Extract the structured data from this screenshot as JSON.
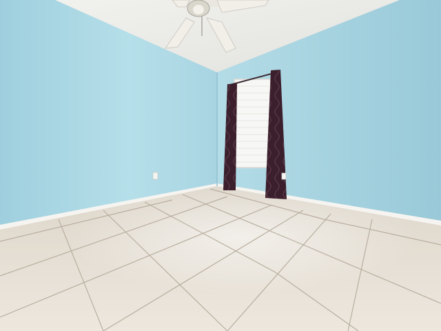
{
  "scene": {
    "subject": "empty room",
    "colors": {
      "wall": "#a9d6e3",
      "wall_shadow": "#9ecbd9",
      "ceiling": "#eeeeea",
      "floor": "#e8e2d8",
      "grout": "#b8ada0",
      "baseboard": "#f4f2ee",
      "curtain": "#3b1f2c",
      "window_glass": "#f7f7f5",
      "fan": "#f1efe8"
    },
    "icons": [
      "ceiling-fan-icon",
      "window-icon",
      "curtain-icon",
      "wall-outlet-icon"
    ]
  }
}
